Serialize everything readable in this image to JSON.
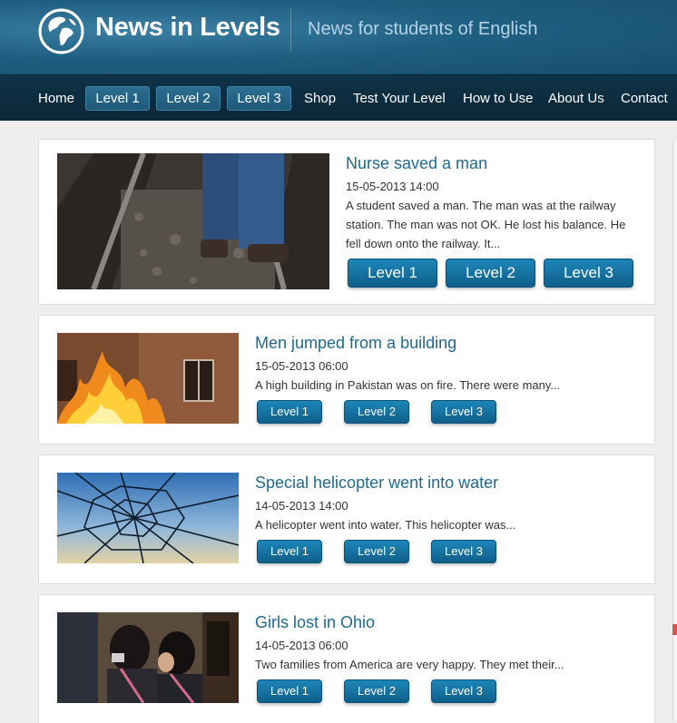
{
  "header": {
    "logo_text": "News in Levels",
    "tagline": "News for students of English"
  },
  "nav": {
    "home": "Home",
    "level1": "Level 1",
    "level2": "Level 2",
    "level3": "Level 3",
    "shop": "Shop",
    "test": "Test Your Level",
    "how": "How to Use",
    "about": "About Us",
    "contact": "Contact"
  },
  "articles": [
    {
      "title": "Nurse saved a man",
      "date": "15-05-2013 14:00",
      "excerpt": "A student saved a man. The man was at the railway station. The man was not OK. He lost his balance. He fell down onto the railway. It...",
      "buttons": [
        "Level 1",
        "Level 2",
        "Level 3"
      ]
    },
    {
      "title": "Men jumped from a building",
      "date": "15-05-2013 06:00",
      "excerpt": "A high building in Pakistan was on fire. There were many...",
      "buttons": [
        "Level 1",
        "Level 2",
        "Level 3"
      ]
    },
    {
      "title": "Special helicopter went into water",
      "date": "14-05-2013 14:00",
      "excerpt": "A helicopter went into water. This helicopter was...",
      "buttons": [
        "Level 1",
        "Level 2",
        "Level 3"
      ]
    },
    {
      "title": "Girls lost in Ohio",
      "date": "14-05-2013 06:00",
      "excerpt": "Two families from America are very happy. They met their...",
      "buttons": [
        "Level 1",
        "Level 2",
        "Level 3"
      ]
    }
  ]
}
